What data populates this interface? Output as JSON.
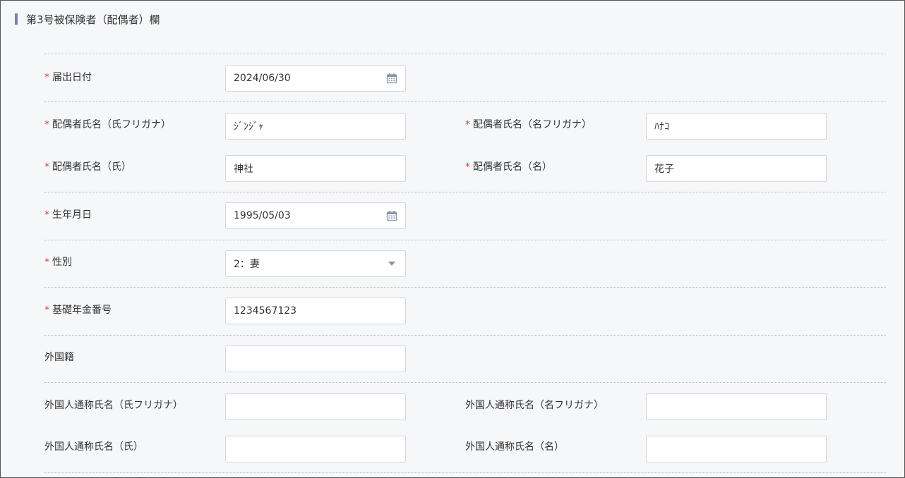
{
  "section": {
    "title": "第3号被保険者（配偶者）欄"
  },
  "required_mark": "*",
  "fields": {
    "notification_date": {
      "label": "届出日付",
      "value": "2024/06/30",
      "icon": "calendar-icon"
    },
    "spouse_last_kana": {
      "label": "配偶者氏名（氏フリガナ）",
      "value": "ｼﾞﾝｼﾞｬ"
    },
    "spouse_first_kana": {
      "label": "配偶者氏名（名フリガナ）",
      "value": "ﾊﾅｺ"
    },
    "spouse_last": {
      "label": "配偶者氏名（氏）",
      "value": "神社"
    },
    "spouse_first": {
      "label": "配偶者氏名（名）",
      "value": "花子"
    },
    "birth_date": {
      "label": "生年月日",
      "value": "1995/05/03",
      "icon": "calendar-icon"
    },
    "gender": {
      "label": "性別",
      "value": "2：妻",
      "icon": "chevron-down-icon"
    },
    "pension_number": {
      "label": "基礎年金番号",
      "value": "1234567123"
    },
    "nationality": {
      "label": "外国籍",
      "value": ""
    },
    "foreign_last_kana": {
      "label": "外国人通称氏名（氏フリガナ）",
      "value": ""
    },
    "foreign_first_kana": {
      "label": "外国人通称氏名（名フリガナ）",
      "value": ""
    },
    "foreign_last": {
      "label": "外国人通称氏名（氏）",
      "value": ""
    },
    "foreign_first": {
      "label": "外国人通称氏名（名）",
      "value": ""
    }
  },
  "colors": {
    "accent_bar": "#7f7fb0",
    "required": "#e0393e",
    "icon": "#8a93a6"
  }
}
